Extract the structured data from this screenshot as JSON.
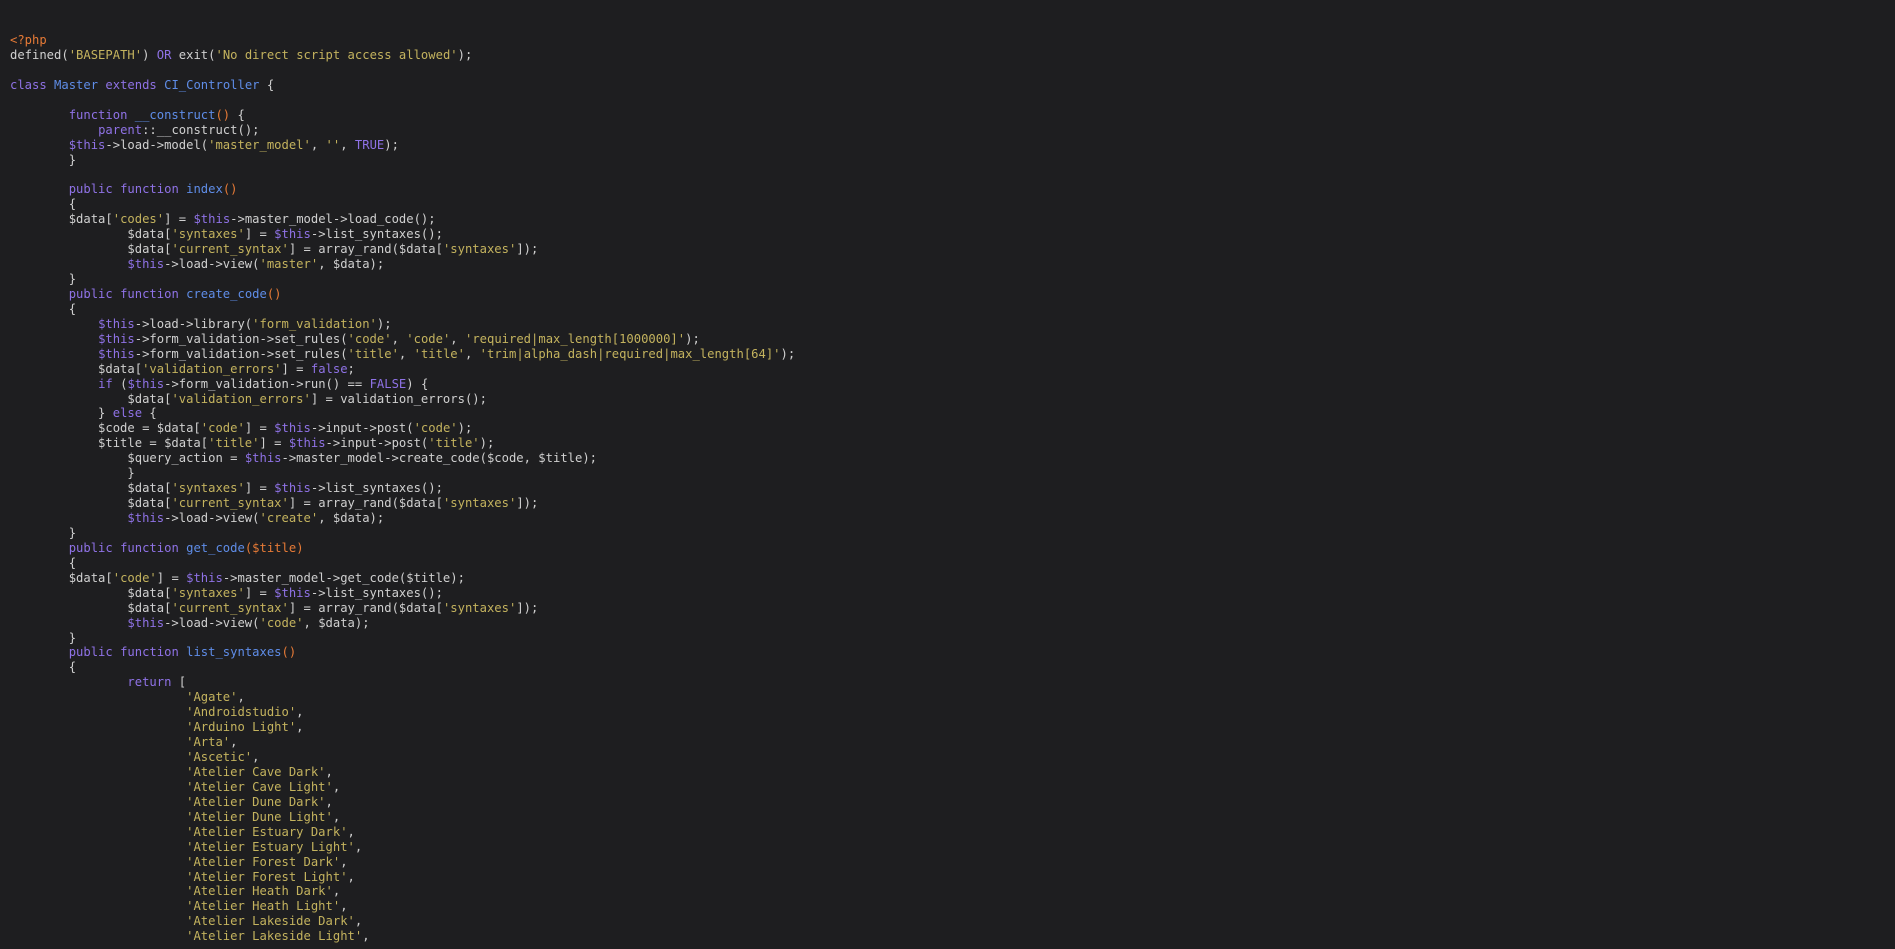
{
  "editor": {
    "language": "php",
    "colors": {
      "background": "#1e1e20",
      "plain": "#d0d0d0",
      "keyword": "#8f72e6",
      "string": "#c4b35e",
      "function": "#5f8de8",
      "preproc_params": "#e67a36"
    },
    "lines": [
      [
        {
          "c": "pr",
          "t": "<?php"
        }
      ],
      [
        {
          "c": "p",
          "t": "defined("
        },
        {
          "c": "s",
          "t": "'BASEPATH'"
        },
        {
          "c": "p",
          "t": ") "
        },
        {
          "c": "k",
          "t": "OR"
        },
        {
          "c": "p",
          "t": " exit("
        },
        {
          "c": "s",
          "t": "'No direct script access allowed'"
        },
        {
          "c": "p",
          "t": ");"
        }
      ],
      [],
      [
        {
          "c": "k",
          "t": "class"
        },
        {
          "c": "p",
          "t": " "
        },
        {
          "c": "f",
          "t": "Master"
        },
        {
          "c": "p",
          "t": " "
        },
        {
          "c": "k",
          "t": "extends"
        },
        {
          "c": "p",
          "t": " "
        },
        {
          "c": "f",
          "t": "CI_Controller"
        },
        {
          "c": "p",
          "t": " {"
        }
      ],
      [],
      [
        {
          "c": "p",
          "t": "        "
        },
        {
          "c": "k",
          "t": "function"
        },
        {
          "c": "p",
          "t": " "
        },
        {
          "c": "f",
          "t": "__construct"
        },
        {
          "c": "pr",
          "t": "()"
        },
        {
          "c": "p",
          "t": " {"
        }
      ],
      [
        {
          "c": "p",
          "t": "            "
        },
        {
          "c": "k",
          "t": "parent"
        },
        {
          "c": "p",
          "t": "::__construct();"
        }
      ],
      [
        {
          "c": "p",
          "t": "        "
        },
        {
          "c": "k",
          "t": "$this"
        },
        {
          "c": "p",
          "t": "->load->model("
        },
        {
          "c": "s",
          "t": "'master_model'"
        },
        {
          "c": "p",
          "t": ", "
        },
        {
          "c": "s",
          "t": "''"
        },
        {
          "c": "p",
          "t": ", "
        },
        {
          "c": "k",
          "t": "TRUE"
        },
        {
          "c": "p",
          "t": ");"
        }
      ],
      [
        {
          "c": "p",
          "t": "        }"
        }
      ],
      [],
      [
        {
          "c": "p",
          "t": "        "
        },
        {
          "c": "k",
          "t": "public"
        },
        {
          "c": "p",
          "t": " "
        },
        {
          "c": "k",
          "t": "function"
        },
        {
          "c": "p",
          "t": " "
        },
        {
          "c": "f",
          "t": "index"
        },
        {
          "c": "pr",
          "t": "()"
        }
      ],
      [
        {
          "c": "p",
          "t": "        {"
        }
      ],
      [
        {
          "c": "p",
          "t": "        $data["
        },
        {
          "c": "s",
          "t": "'codes'"
        },
        {
          "c": "p",
          "t": "] = "
        },
        {
          "c": "k",
          "t": "$this"
        },
        {
          "c": "p",
          "t": "->master_model->load_code();"
        }
      ],
      [
        {
          "c": "p",
          "t": "                $data["
        },
        {
          "c": "s",
          "t": "'syntaxes'"
        },
        {
          "c": "p",
          "t": "] = "
        },
        {
          "c": "k",
          "t": "$this"
        },
        {
          "c": "p",
          "t": "->list_syntaxes();"
        }
      ],
      [
        {
          "c": "p",
          "t": "                $data["
        },
        {
          "c": "s",
          "t": "'current_syntax'"
        },
        {
          "c": "p",
          "t": "] = array_rand($data["
        },
        {
          "c": "s",
          "t": "'syntaxes'"
        },
        {
          "c": "p",
          "t": "]);"
        }
      ],
      [
        {
          "c": "p",
          "t": "                "
        },
        {
          "c": "k",
          "t": "$this"
        },
        {
          "c": "p",
          "t": "->load->view("
        },
        {
          "c": "s",
          "t": "'master'"
        },
        {
          "c": "p",
          "t": ", $data);"
        }
      ],
      [
        {
          "c": "p",
          "t": "        }"
        }
      ],
      [
        {
          "c": "p",
          "t": "        "
        },
        {
          "c": "k",
          "t": "public"
        },
        {
          "c": "p",
          "t": " "
        },
        {
          "c": "k",
          "t": "function"
        },
        {
          "c": "p",
          "t": " "
        },
        {
          "c": "f",
          "t": "create_code"
        },
        {
          "c": "pr",
          "t": "()"
        }
      ],
      [
        {
          "c": "p",
          "t": "        {"
        }
      ],
      [
        {
          "c": "p",
          "t": "            "
        },
        {
          "c": "k",
          "t": "$this"
        },
        {
          "c": "p",
          "t": "->load->library("
        },
        {
          "c": "s",
          "t": "'form_validation'"
        },
        {
          "c": "p",
          "t": ");"
        }
      ],
      [
        {
          "c": "p",
          "t": "            "
        },
        {
          "c": "k",
          "t": "$this"
        },
        {
          "c": "p",
          "t": "->form_validation->set_rules("
        },
        {
          "c": "s",
          "t": "'code'"
        },
        {
          "c": "p",
          "t": ", "
        },
        {
          "c": "s",
          "t": "'code'"
        },
        {
          "c": "p",
          "t": ", "
        },
        {
          "c": "s",
          "t": "'required|max_length[1000000]'"
        },
        {
          "c": "p",
          "t": ");"
        }
      ],
      [
        {
          "c": "p",
          "t": "            "
        },
        {
          "c": "k",
          "t": "$this"
        },
        {
          "c": "p",
          "t": "->form_validation->set_rules("
        },
        {
          "c": "s",
          "t": "'title'"
        },
        {
          "c": "p",
          "t": ", "
        },
        {
          "c": "s",
          "t": "'title'"
        },
        {
          "c": "p",
          "t": ", "
        },
        {
          "c": "s",
          "t": "'trim|alpha_dash|required|max_length[64]'"
        },
        {
          "c": "p",
          "t": ");"
        }
      ],
      [
        {
          "c": "p",
          "t": "            $data["
        },
        {
          "c": "s",
          "t": "'validation_errors'"
        },
        {
          "c": "p",
          "t": "] = "
        },
        {
          "c": "k",
          "t": "false"
        },
        {
          "c": "p",
          "t": ";"
        }
      ],
      [
        {
          "c": "p",
          "t": "            "
        },
        {
          "c": "k",
          "t": "if"
        },
        {
          "c": "p",
          "t": " ("
        },
        {
          "c": "k",
          "t": "$this"
        },
        {
          "c": "p",
          "t": "->form_validation->run() == "
        },
        {
          "c": "k",
          "t": "FALSE"
        },
        {
          "c": "p",
          "t": ") {"
        }
      ],
      [
        {
          "c": "p",
          "t": "                $data["
        },
        {
          "c": "s",
          "t": "'validation_errors'"
        },
        {
          "c": "p",
          "t": "] = validation_errors();"
        }
      ],
      [
        {
          "c": "p",
          "t": "            } "
        },
        {
          "c": "k",
          "t": "else"
        },
        {
          "c": "p",
          "t": " {"
        }
      ],
      [
        {
          "c": "p",
          "t": "            $code = $data["
        },
        {
          "c": "s",
          "t": "'code'"
        },
        {
          "c": "p",
          "t": "] = "
        },
        {
          "c": "k",
          "t": "$this"
        },
        {
          "c": "p",
          "t": "->input->post("
        },
        {
          "c": "s",
          "t": "'code'"
        },
        {
          "c": "p",
          "t": ");"
        }
      ],
      [
        {
          "c": "p",
          "t": "            $title = $data["
        },
        {
          "c": "s",
          "t": "'title'"
        },
        {
          "c": "p",
          "t": "] = "
        },
        {
          "c": "k",
          "t": "$this"
        },
        {
          "c": "p",
          "t": "->input->post("
        },
        {
          "c": "s",
          "t": "'title'"
        },
        {
          "c": "p",
          "t": ");"
        }
      ],
      [
        {
          "c": "p",
          "t": "                $query_action = "
        },
        {
          "c": "k",
          "t": "$this"
        },
        {
          "c": "p",
          "t": "->master_model->create_code($code, $title);"
        }
      ],
      [
        {
          "c": "p",
          "t": "                }"
        }
      ],
      [
        {
          "c": "p",
          "t": "                $data["
        },
        {
          "c": "s",
          "t": "'syntaxes'"
        },
        {
          "c": "p",
          "t": "] = "
        },
        {
          "c": "k",
          "t": "$this"
        },
        {
          "c": "p",
          "t": "->list_syntaxes();"
        }
      ],
      [
        {
          "c": "p",
          "t": "                $data["
        },
        {
          "c": "s",
          "t": "'current_syntax'"
        },
        {
          "c": "p",
          "t": "] = array_rand($data["
        },
        {
          "c": "s",
          "t": "'syntaxes'"
        },
        {
          "c": "p",
          "t": "]);"
        }
      ],
      [
        {
          "c": "p",
          "t": "                "
        },
        {
          "c": "k",
          "t": "$this"
        },
        {
          "c": "p",
          "t": "->load->view("
        },
        {
          "c": "s",
          "t": "'create'"
        },
        {
          "c": "p",
          "t": ", $data);"
        }
      ],
      [
        {
          "c": "p",
          "t": "        }"
        }
      ],
      [
        {
          "c": "p",
          "t": "        "
        },
        {
          "c": "k",
          "t": "public"
        },
        {
          "c": "p",
          "t": " "
        },
        {
          "c": "k",
          "t": "function"
        },
        {
          "c": "p",
          "t": " "
        },
        {
          "c": "f",
          "t": "get_code"
        },
        {
          "c": "pr",
          "t": "($title)"
        }
      ],
      [
        {
          "c": "p",
          "t": "        {"
        }
      ],
      [
        {
          "c": "p",
          "t": "        $data["
        },
        {
          "c": "s",
          "t": "'code'"
        },
        {
          "c": "p",
          "t": "] = "
        },
        {
          "c": "k",
          "t": "$this"
        },
        {
          "c": "p",
          "t": "->master_model->get_code($title);"
        }
      ],
      [
        {
          "c": "p",
          "t": "                $data["
        },
        {
          "c": "s",
          "t": "'syntaxes'"
        },
        {
          "c": "p",
          "t": "] = "
        },
        {
          "c": "k",
          "t": "$this"
        },
        {
          "c": "p",
          "t": "->list_syntaxes();"
        }
      ],
      [
        {
          "c": "p",
          "t": "                $data["
        },
        {
          "c": "s",
          "t": "'current_syntax'"
        },
        {
          "c": "p",
          "t": "] = array_rand($data["
        },
        {
          "c": "s",
          "t": "'syntaxes'"
        },
        {
          "c": "p",
          "t": "]);"
        }
      ],
      [
        {
          "c": "p",
          "t": "                "
        },
        {
          "c": "k",
          "t": "$this"
        },
        {
          "c": "p",
          "t": "->load->view("
        },
        {
          "c": "s",
          "t": "'code'"
        },
        {
          "c": "p",
          "t": ", $data);"
        }
      ],
      [
        {
          "c": "p",
          "t": "        }"
        }
      ],
      [
        {
          "c": "p",
          "t": "        "
        },
        {
          "c": "k",
          "t": "public"
        },
        {
          "c": "p",
          "t": " "
        },
        {
          "c": "k",
          "t": "function"
        },
        {
          "c": "p",
          "t": " "
        },
        {
          "c": "f",
          "t": "list_syntaxes"
        },
        {
          "c": "pr",
          "t": "()"
        }
      ],
      [
        {
          "c": "p",
          "t": "        {"
        }
      ],
      [
        {
          "c": "p",
          "t": "                "
        },
        {
          "c": "k",
          "t": "return"
        },
        {
          "c": "p",
          "t": " ["
        }
      ],
      [
        {
          "c": "p",
          "t": "                        "
        },
        {
          "c": "s",
          "t": "'Agate'"
        },
        {
          "c": "p",
          "t": ","
        }
      ],
      [
        {
          "c": "p",
          "t": "                        "
        },
        {
          "c": "s",
          "t": "'Androidstudio'"
        },
        {
          "c": "p",
          "t": ","
        }
      ],
      [
        {
          "c": "p",
          "t": "                        "
        },
        {
          "c": "s",
          "t": "'Arduino Light'"
        },
        {
          "c": "p",
          "t": ","
        }
      ],
      [
        {
          "c": "p",
          "t": "                        "
        },
        {
          "c": "s",
          "t": "'Arta'"
        },
        {
          "c": "p",
          "t": ","
        }
      ],
      [
        {
          "c": "p",
          "t": "                        "
        },
        {
          "c": "s",
          "t": "'Ascetic'"
        },
        {
          "c": "p",
          "t": ","
        }
      ],
      [
        {
          "c": "p",
          "t": "                        "
        },
        {
          "c": "s",
          "t": "'Atelier Cave Dark'"
        },
        {
          "c": "p",
          "t": ","
        }
      ],
      [
        {
          "c": "p",
          "t": "                        "
        },
        {
          "c": "s",
          "t": "'Atelier Cave Light'"
        },
        {
          "c": "p",
          "t": ","
        }
      ],
      [
        {
          "c": "p",
          "t": "                        "
        },
        {
          "c": "s",
          "t": "'Atelier Dune Dark'"
        },
        {
          "c": "p",
          "t": ","
        }
      ],
      [
        {
          "c": "p",
          "t": "                        "
        },
        {
          "c": "s",
          "t": "'Atelier Dune Light'"
        },
        {
          "c": "p",
          "t": ","
        }
      ],
      [
        {
          "c": "p",
          "t": "                        "
        },
        {
          "c": "s",
          "t": "'Atelier Estuary Dark'"
        },
        {
          "c": "p",
          "t": ","
        }
      ],
      [
        {
          "c": "p",
          "t": "                        "
        },
        {
          "c": "s",
          "t": "'Atelier Estuary Light'"
        },
        {
          "c": "p",
          "t": ","
        }
      ],
      [
        {
          "c": "p",
          "t": "                        "
        },
        {
          "c": "s",
          "t": "'Atelier Forest Dark'"
        },
        {
          "c": "p",
          "t": ","
        }
      ],
      [
        {
          "c": "p",
          "t": "                        "
        },
        {
          "c": "s",
          "t": "'Atelier Forest Light'"
        },
        {
          "c": "p",
          "t": ","
        }
      ],
      [
        {
          "c": "p",
          "t": "                        "
        },
        {
          "c": "s",
          "t": "'Atelier Heath Dark'"
        },
        {
          "c": "p",
          "t": ","
        }
      ],
      [
        {
          "c": "p",
          "t": "                        "
        },
        {
          "c": "s",
          "t": "'Atelier Heath Light'"
        },
        {
          "c": "p",
          "t": ","
        }
      ],
      [
        {
          "c": "p",
          "t": "                        "
        },
        {
          "c": "s",
          "t": "'Atelier Lakeside Dark'"
        },
        {
          "c": "p",
          "t": ","
        }
      ],
      [
        {
          "c": "p",
          "t": "                        "
        },
        {
          "c": "s",
          "t": "'Atelier Lakeside Light'"
        },
        {
          "c": "p",
          "t": ","
        }
      ]
    ]
  }
}
